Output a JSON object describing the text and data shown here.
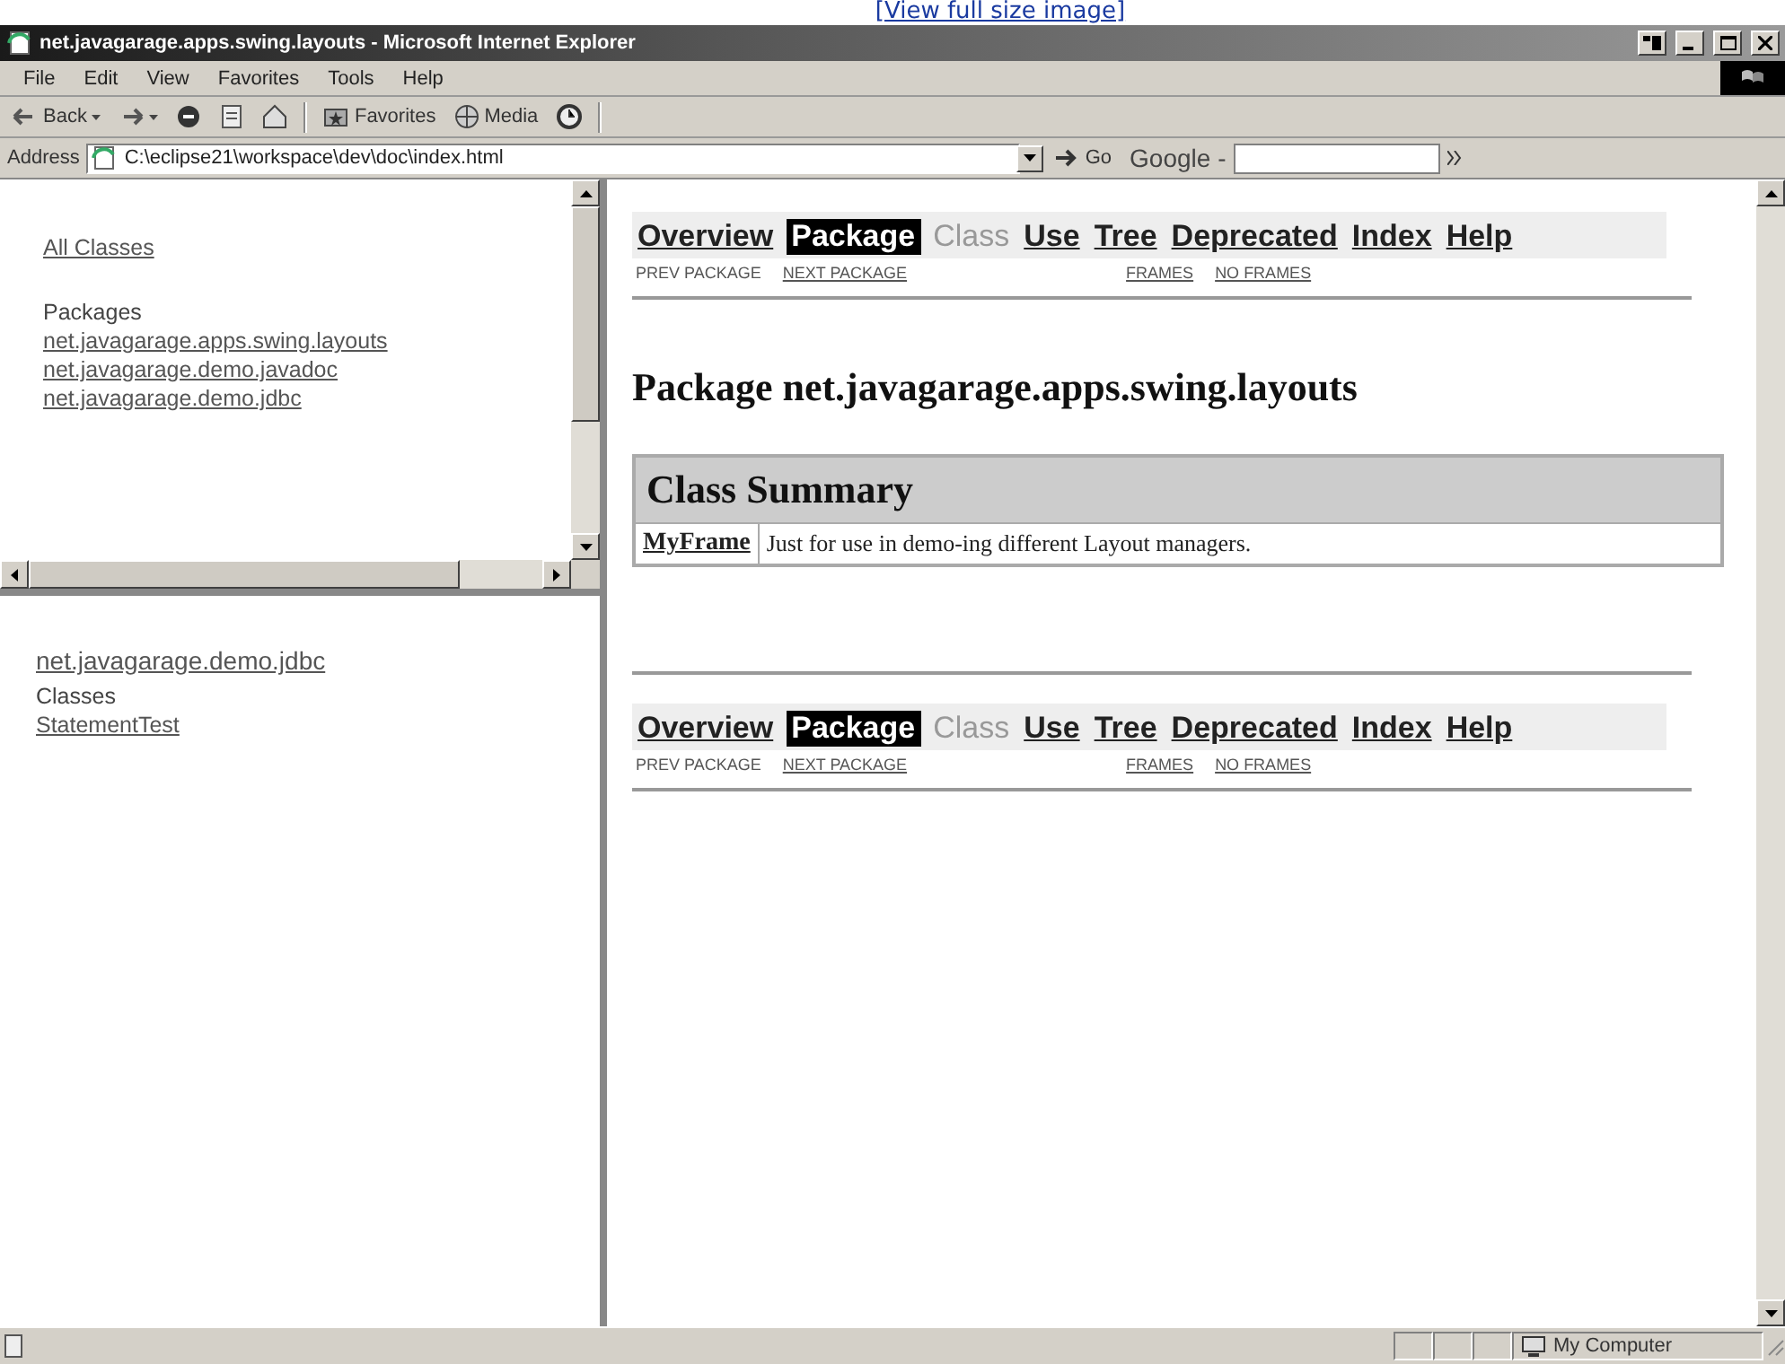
{
  "page_link": "[View full size image]",
  "window": {
    "title": "net.javagarage.apps.swing.layouts - Microsoft Internet Explorer"
  },
  "menu": [
    "File",
    "Edit",
    "View",
    "Favorites",
    "Tools",
    "Help"
  ],
  "toolbar": [
    {
      "kind": "back",
      "label": "Back"
    },
    {
      "kind": "forward"
    },
    {
      "kind": "stop"
    },
    {
      "kind": "refresh"
    },
    {
      "kind": "home"
    },
    {
      "kind": "favorites",
      "label": "Favorites"
    },
    {
      "kind": "media",
      "label": "Media"
    },
    {
      "kind": "history"
    }
  ],
  "address": {
    "label": "Address",
    "value": "C:\\eclipse21\\workspace\\dev\\doc\\index.html",
    "go": "Go",
    "search_label": "Google -"
  },
  "packages_frame": {
    "all_classes": "All Classes",
    "heading": "Packages",
    "packages": [
      "net.javagarage.apps.swing.layouts",
      "net.javagarage.demo.javadoc",
      "net.javagarage.demo.jdbc"
    ]
  },
  "classes_frame": {
    "package": "net.javagarage.demo.jdbc",
    "heading": "Classes",
    "classes": [
      "StatementTest"
    ]
  },
  "content": {
    "navbars": [
      {
        "items": [
          {
            "label": "Overview",
            "selected": false,
            "disabled": false
          },
          {
            "label": "Package",
            "selected": true,
            "disabled": false
          },
          {
            "label": "Class",
            "selected": false,
            "disabled": true
          },
          {
            "label": "Use",
            "selected": false,
            "disabled": false
          },
          {
            "label": "Tree",
            "selected": false,
            "disabled": false
          },
          {
            "label": "Deprecated",
            "selected": false,
            "disabled": false
          },
          {
            "label": "Index",
            "selected": false,
            "disabled": false
          },
          {
            "label": "Help",
            "selected": false,
            "disabled": false
          }
        ],
        "sublinks": [
          {
            "label": "PREV PACKAGE",
            "link": false
          },
          {
            "label": "NEXT PACKAGE",
            "link": true
          }
        ],
        "frame_links": [
          {
            "label": "FRAMES",
            "link": true
          },
          {
            "label": "NO FRAMES",
            "link": true
          }
        ]
      },
      {
        "items": [
          {
            "label": "Overview",
            "selected": false,
            "disabled": false
          },
          {
            "label": "Package",
            "selected": true,
            "disabled": false
          },
          {
            "label": "Class",
            "selected": false,
            "disabled": true
          },
          {
            "label": "Use",
            "selected": false,
            "disabled": false
          },
          {
            "label": "Tree",
            "selected": false,
            "disabled": false
          },
          {
            "label": "Deprecated",
            "selected": false,
            "disabled": false
          },
          {
            "label": "Index",
            "selected": false,
            "disabled": false
          },
          {
            "label": "Help",
            "selected": false,
            "disabled": false
          }
        ],
        "sublinks": [
          {
            "label": "PREV PACKAGE",
            "link": false
          },
          {
            "label": "NEXT PACKAGE",
            "link": true
          }
        ],
        "frame_links": [
          {
            "label": "FRAMES",
            "link": true
          },
          {
            "label": "NO FRAMES",
            "link": true
          }
        ]
      }
    ],
    "title": "Package net.javagarage.apps.swing.layouts",
    "summary": {
      "heading": "Class Summary",
      "rows": [
        {
          "name": "MyFrame",
          "description": "Just for use in demo-ing different Layout managers."
        }
      ]
    }
  },
  "status": {
    "zone": "My Computer"
  }
}
